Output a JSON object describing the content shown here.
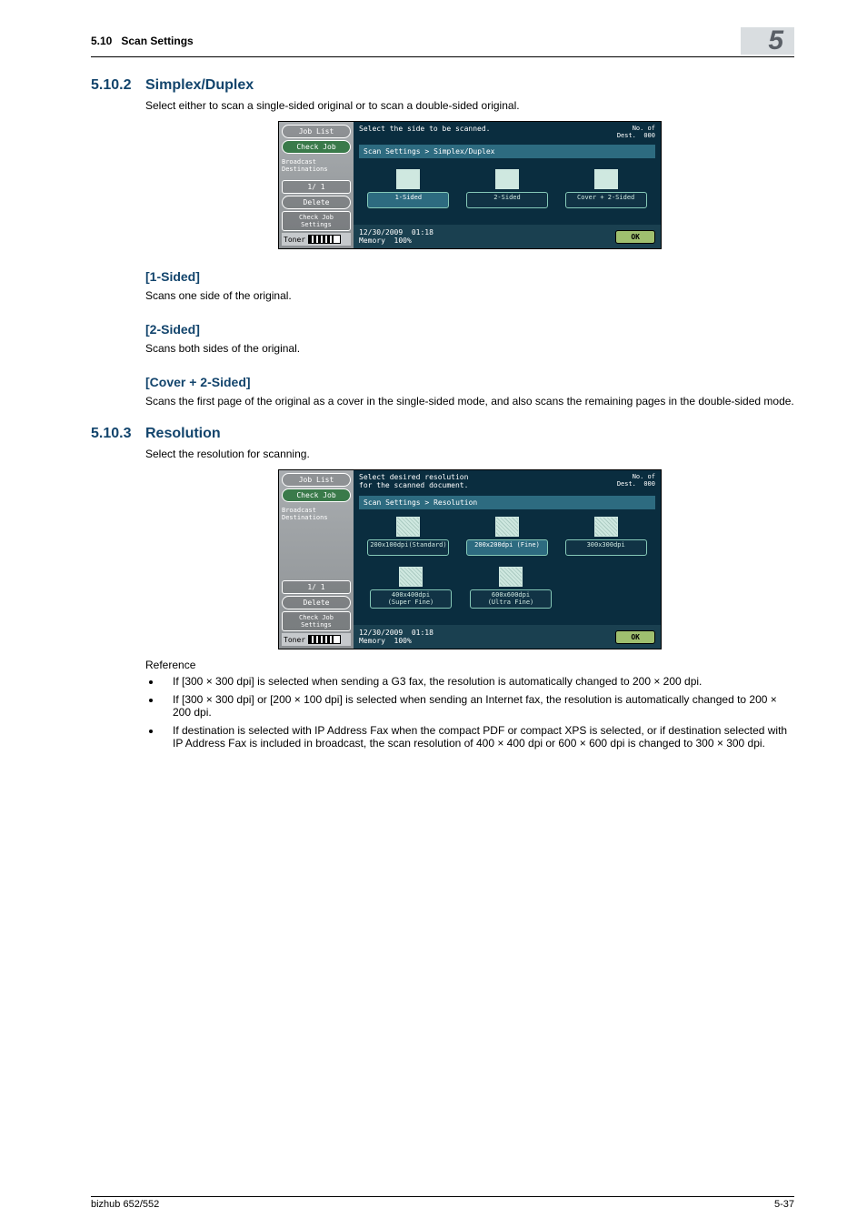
{
  "header": {
    "section_no": "5.10",
    "section_label": "Scan Settings",
    "chapter": "5"
  },
  "sec1": {
    "num": "5.10.2",
    "title": "Simplex/Duplex",
    "intro": "Select either to scan a single-sided original or to scan a double-sided original.",
    "sub1_title": "[1-Sided]",
    "sub1_text": "Scans one side of the original.",
    "sub2_title": "[2-Sided]",
    "sub2_text": "Scans both sides of the original.",
    "sub3_title": "[Cover + 2-Sided]",
    "sub3_text": "Scans the first page of the original as a cover in the single-sided mode, and also scans the remaining pages in the double-sided mode."
  },
  "sec2": {
    "num": "5.10.3",
    "title": "Resolution",
    "intro": "Select the resolution for scanning.",
    "ref_label": "Reference",
    "bullets": [
      "If [300 × 300 dpi] is selected when sending a G3 fax, the resolution is automatically changed to 200 × 200 dpi.",
      "If [300 × 300 dpi] or [200 × 100 dpi] is selected when sending an Internet fax, the resolution is automatically changed to 200 × 200 dpi.",
      "If destination is selected with IP Address Fax when the compact PDF or compact XPS is selected, or if destination selected with IP Address Fax is included in broadcast, the scan resolution of 400 × 400 dpi or 600 × 600 dpi is changed to 300 × 300 dpi."
    ]
  },
  "panel_common": {
    "job_list": "Job List",
    "check_job": "Check Job",
    "broadcast": "Broadcast\nDestinations",
    "page_ind": "1/  1",
    "delete": "Delete",
    "check_settings": "Check Job\nSettings",
    "toner": "Toner",
    "dest_label": "No. of\nDest.",
    "dest_val": "000",
    "date": "12/30/2009",
    "time": "01:18",
    "memory": "Memory",
    "mem_val": "100%",
    "ok": "OK"
  },
  "panel1": {
    "instruction": "Select the side to be scanned.",
    "breadcrumb": "Scan Settings > Simplex/Duplex",
    "opts": [
      "1-Sided",
      "2-Sided",
      "Cover + 2-Sided"
    ]
  },
  "panel2": {
    "instruction": "Select desired resolution\nfor the scanned document.",
    "breadcrumb": "Scan Settings > Resolution",
    "opts_row1": [
      "200x100dpi(Standard)",
      "200x200dpi (Fine)",
      "300x300dpi"
    ],
    "opts_row2": [
      "400x400dpi\n(Super Fine)",
      "600x600dpi\n(Ultra Fine)"
    ]
  },
  "footer": {
    "left": "bizhub 652/552",
    "right": "5-37"
  }
}
